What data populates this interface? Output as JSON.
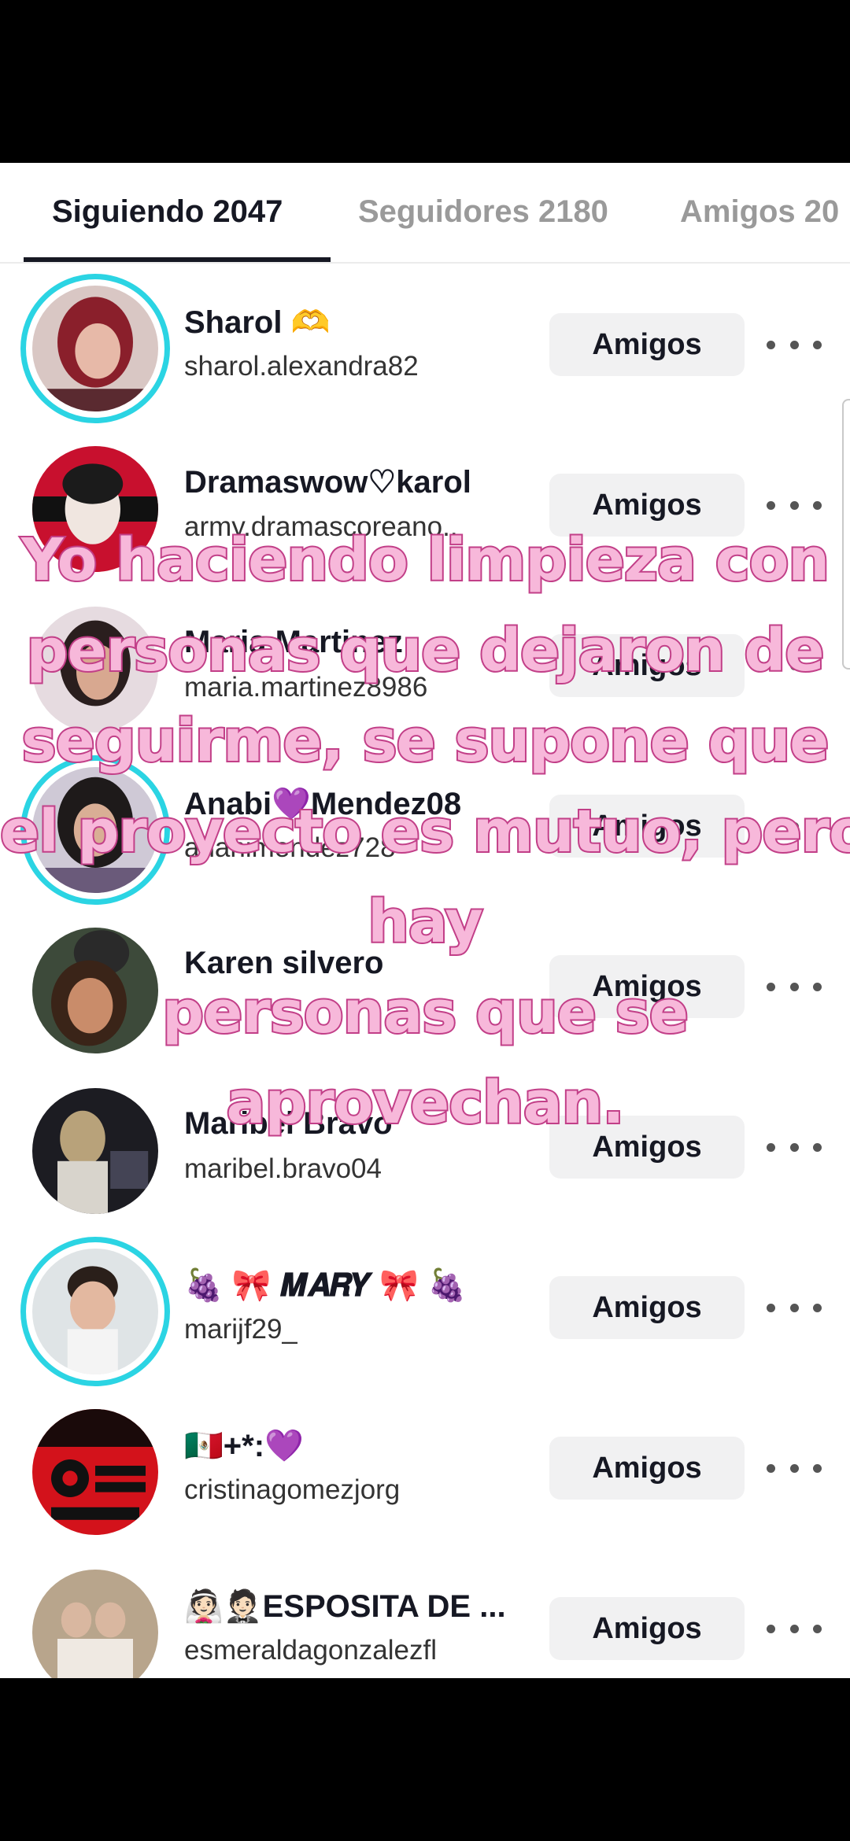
{
  "tabs": [
    {
      "label": "Siguiendo 2047"
    },
    {
      "label": "Seguidores 2180"
    },
    {
      "label": "Amigos 20"
    }
  ],
  "colors": {
    "ring": "#2bd4e3",
    "overlay_fill": "#f7b8da",
    "overlay_stroke": "#c23f88"
  },
  "users": [
    {
      "name": "Sharol 🫶",
      "handle": "sharol.alexandra82",
      "button": "Amigos",
      "ring": true
    },
    {
      "name": "Dramaswow♡karol",
      "handle": "army.dramascoreano..",
      "button": "Amigos",
      "ring": false
    },
    {
      "name": "Maria Martinez",
      "handle": "maria.martinez8986",
      "button": "Amigos",
      "ring": false
    },
    {
      "name": "Anabi💜Mendez08",
      "handle": "anahimendez728",
      "button": "Amigos",
      "ring": true
    },
    {
      "name": "Karen silvero",
      "handle": "",
      "button": "Amigos",
      "ring": false
    },
    {
      "name": "Maribel Bravo",
      "handle": "maribel.bravo04",
      "button": "Amigos",
      "ring": false
    },
    {
      "name": "🍇 🎀 𝑴𝑨𝑹𝒀 🎀 🍇",
      "handle": "marijf29_",
      "button": "Amigos",
      "ring": true
    },
    {
      "name": "🇲🇽+*:💜",
      "handle": "cristinagomezjorg",
      "button": "Amigos",
      "ring": false
    },
    {
      "name": "👰🏻🤵🏻ESPOSITA DE ...",
      "handle": "esmeraldagonzalezfl",
      "button": "Amigos",
      "ring": false
    }
  ],
  "overlay": {
    "lines": [
      "Yo haciendo limpieza con",
      "personas que dejaron de",
      "seguirme, se supone que",
      "el proyecto es mutuo, pero",
      "hay",
      "personas que se",
      "aprovechan."
    ]
  }
}
